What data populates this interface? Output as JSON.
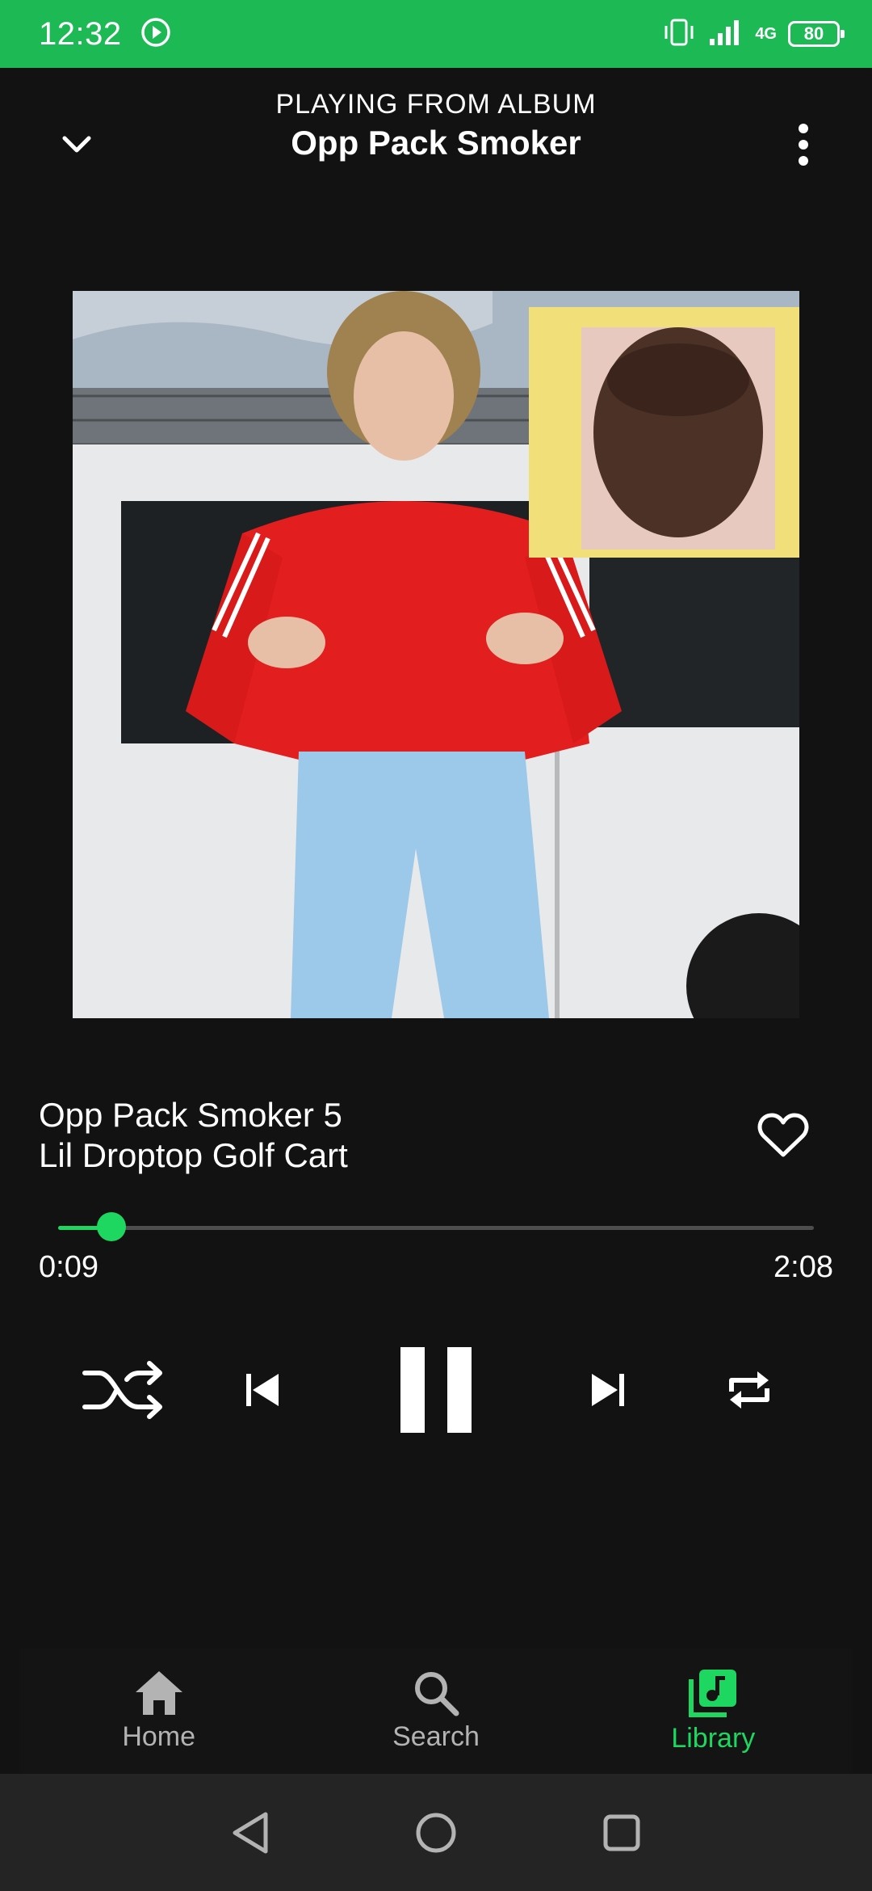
{
  "status_bar": {
    "time": "12:32",
    "network": "4G",
    "battery": "80"
  },
  "header": {
    "context_label": "PLAYING FROM ALBUM",
    "album_title": "Opp Pack Smoker"
  },
  "track": {
    "title": "Opp Pack Smoker 5",
    "artist": "Lil Droptop Golf Cart"
  },
  "playback": {
    "elapsed": "0:09",
    "total": "2:08",
    "progress_fraction": 0.07
  },
  "bottom_nav": {
    "items": [
      {
        "label": "Home",
        "icon": "home-icon",
        "active": false
      },
      {
        "label": "Search",
        "icon": "search-icon",
        "active": false
      },
      {
        "label": "Library",
        "icon": "library-icon",
        "active": true
      }
    ]
  },
  "colors": {
    "accent": "#1ed760",
    "status_bar": "#1db954",
    "background": "#121212"
  }
}
